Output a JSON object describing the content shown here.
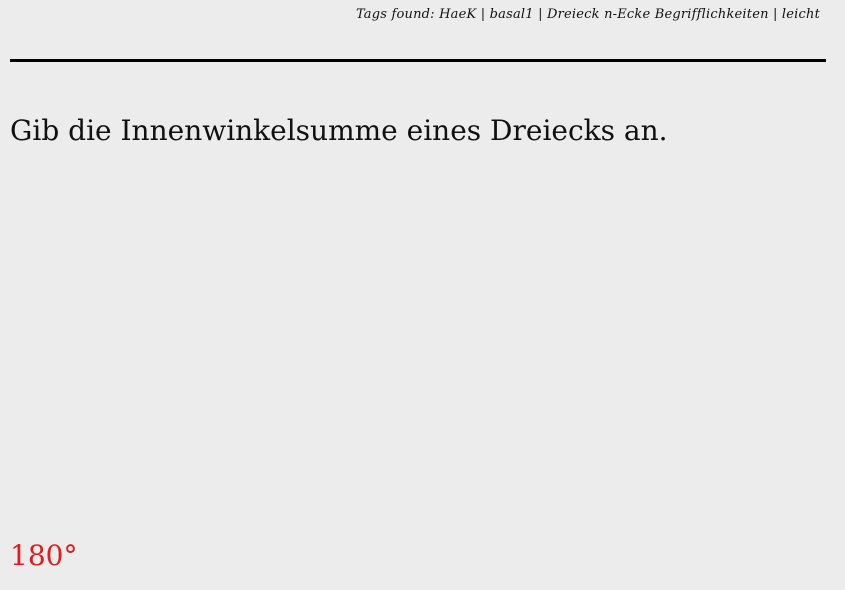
{
  "header": {
    "tags_line": "Tags found: HaeK | basal1 | Dreieck n-Ecke Begrifflichkeiten | leicht"
  },
  "question": {
    "text": "Gib die Innenwinkelsumme eines Dreiecks an."
  },
  "answer": {
    "text": "180°",
    "color": "#e01c1c"
  }
}
